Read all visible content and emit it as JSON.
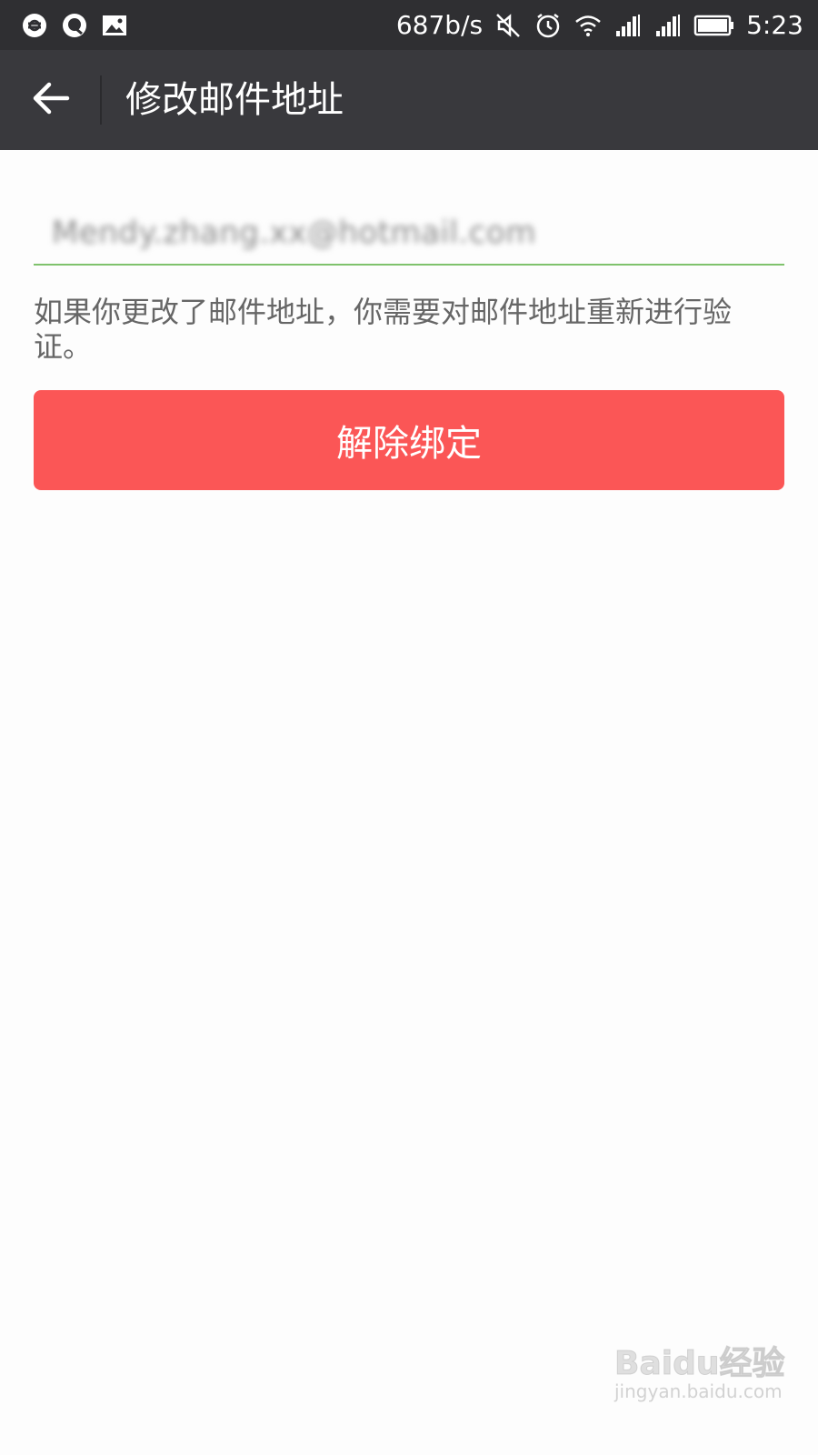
{
  "status_bar": {
    "notification_icons": [
      "browser-icon",
      "qq-icon",
      "image-icon"
    ],
    "network_speed": "687b/s",
    "system_icons": [
      "mute-icon",
      "alarm-icon",
      "wifi-icon",
      "signal-icon",
      "signal-icon",
      "battery-icon"
    ],
    "time": "5:23"
  },
  "header": {
    "back_icon": "arrow-left-icon",
    "title": "修改邮件地址"
  },
  "email_input": {
    "value": "Mendy.zhang.xx@hotmail.com",
    "value_is_obscured": true,
    "focus_underline_color": "#7fc26c"
  },
  "hint": {
    "text": "如果你更改了邮件地址，你需要对邮件地址重新进行验证。"
  },
  "unbind_button": {
    "label": "解除绑定",
    "color": "#fb5656"
  },
  "watermark": {
    "brand": "Baidu经验",
    "url": "jingyan.baidu.com"
  },
  "colors": {
    "status_bar_bg": "#2f2f32",
    "action_bar_bg": "#39393d",
    "page_bg": "#fdfdfd"
  }
}
